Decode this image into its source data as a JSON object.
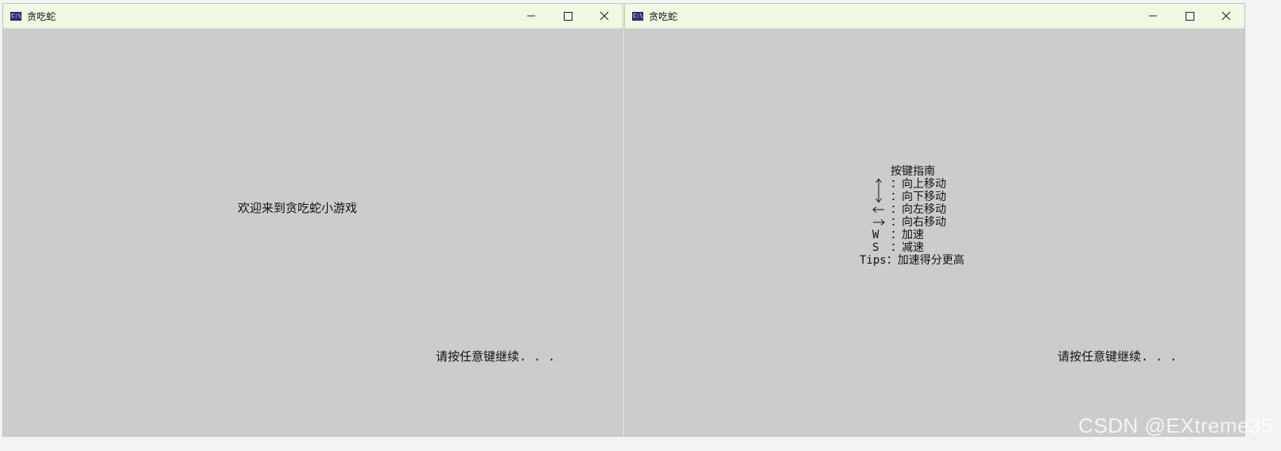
{
  "windows": [
    {
      "title": "贪吃蛇",
      "icon": "console-app-icon",
      "icon_text": "C:\\",
      "welcome": "欢迎来到贪吃蛇小游戏",
      "continue": "请按任意键继续. . ."
    },
    {
      "title": "贪吃蛇",
      "icon": "console-app-icon",
      "icon_text": "C:\\",
      "guide": {
        "heading": "按键指南",
        "up": "：向上移动",
        "down": "：向下移动",
        "left": "：向左移动",
        "right": "：向右移动",
        "w_key": "W",
        "w_text": "：加速",
        "s_key": "S",
        "s_text": "：减速",
        "tips": "Tips：加速得分更高"
      },
      "continue": "请按任意键继续. . ."
    }
  ],
  "controls": {
    "minimize": "minimize-icon",
    "maximize": "maximize-icon",
    "close": "close-icon"
  },
  "watermark": "CSDN @EXtreme35",
  "colors": {
    "titlebar": "#eef8e3",
    "console_bg": "#cccccc",
    "text": "#111111"
  }
}
